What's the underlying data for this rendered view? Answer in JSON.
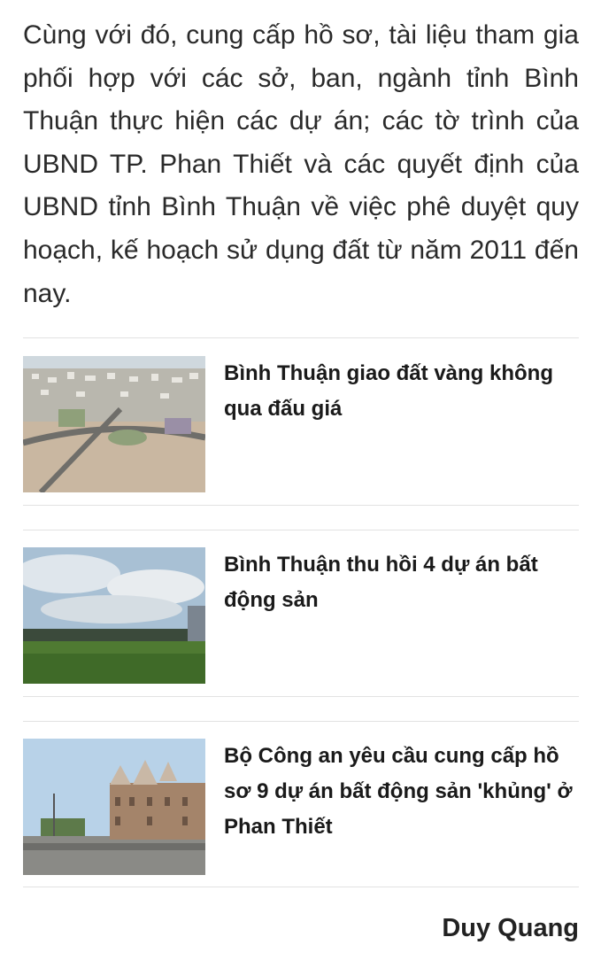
{
  "article": {
    "paragraph": "Cùng với đó, cung cấp hồ sơ, tài liệu tham gia phối hợp với các sở, ban, ngành tỉnh Bình Thuận thực hiện các dự án; các tờ trình của UBND TP. Phan Thiết và các quyết định của UBND tỉnh Bình Thuận về việc phê duyệt quy hoạch, kế hoạch sử dụng đất từ năm 2011 đến nay."
  },
  "related": [
    {
      "title": "Bình Thuận giao đất vàng không qua đấu giá",
      "thumb_icon": "aerial-city-photo"
    },
    {
      "title": "Bình Thuận thu hồi 4 dự án bất động sản",
      "thumb_icon": "field-sky-photo"
    },
    {
      "title": "Bộ Công an yêu cầu cung cấp hồ sơ 9 dự án bất động sản 'khủng' ở Phan Thiết",
      "thumb_icon": "castle-building-photo"
    }
  ],
  "author": "Duy Quang"
}
